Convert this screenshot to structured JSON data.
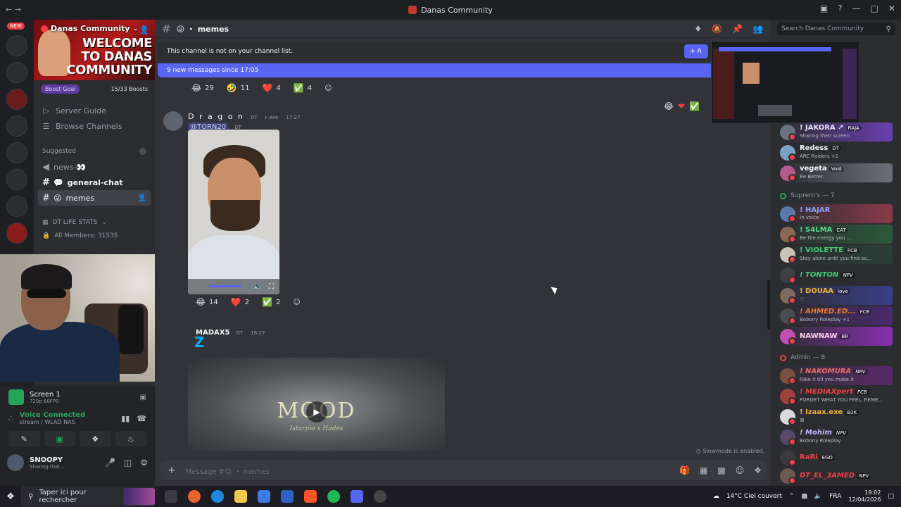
{
  "window": {
    "title": "Danas Community",
    "nav": "←  →"
  },
  "rail": {
    "new_badge": "NEW"
  },
  "server": {
    "name": "Danas Community",
    "banner_text_1": "WELCOME",
    "banner_text_2": "TO DANAS",
    "banner_text_3": "COMMUNITY",
    "boost_label": "Boost Goal",
    "boost_count": "15/33 Boosts",
    "boost_progress": 0.4545
  },
  "sidebar": {
    "server_guide": "Server Guide",
    "browse_channels": "Browse Channels",
    "suggested_label": "Suggested",
    "channels": [
      {
        "icon": "◀",
        "label": "news-👀"
      },
      {
        "icon": "💬",
        "label": "general-chat"
      },
      {
        "icon": "😜",
        "label": "memes"
      }
    ],
    "stats_label": "DT LIFE STATS",
    "all_members": "All Members: 31535"
  },
  "voice": {
    "screen_title": "Screen 1",
    "screen_sub": "720p 60FPS",
    "connected_label": "Voice Connected",
    "connected_sub": "stream / WLAD NAS"
  },
  "user": {
    "name": "SNOOPY",
    "status": "Sharing thei..."
  },
  "channel": {
    "name": "😜 ・ memes",
    "not_listed": "This channel is not on your channel list.",
    "add_button": "+ A",
    "new_messages": "9 new messages since 17:05",
    "reactions_top": [
      {
        "emoji": "😂",
        "count": "29"
      },
      {
        "emoji": "🤣",
        "count": "11"
      },
      {
        "emoji": "❤️",
        "count": "4"
      },
      {
        "emoji": "✅",
        "count": "4"
      }
    ],
    "slowmode": "Slowmode is enabled.",
    "composer_placeholder": "Message #😜 ・ memes"
  },
  "messages": [
    {
      "author": "D r a g o n",
      "tag": "DT",
      "app_tag": "+.exe",
      "time": "17:27",
      "mention": "@TORN20",
      "mention_tag": "DT",
      "reactions": [
        {
          "emoji": "😂",
          "count": "14"
        },
        {
          "emoji": "❤️",
          "count": "2"
        },
        {
          "emoji": "✅",
          "count": "2"
        }
      ]
    },
    {
      "author": "MADAX5",
      "tag": "DT",
      "time": "18:27",
      "text": "Z",
      "media_title": "MOOD",
      "media_sub": "Isturpio x Hades"
    }
  ],
  "members": {
    "search_placeholder": "Search Danas Community",
    "top": [
      {
        "name": "! JAKORA ↗",
        "badge": "RAJA",
        "status": "Sharing their screen",
        "color": "#e8e3ff"
      },
      {
        "name": "Redess",
        "badge": "DT",
        "status": "ARC Raiders +1",
        "color": "#f2f3f5"
      },
      {
        "name": "vegeta",
        "badge": "Void",
        "status": "Be Better.",
        "color": "#f2f3f5"
      }
    ],
    "group1": "Suprem's — 7",
    "supremes": [
      {
        "name": "! HAJAR",
        "badge": "",
        "status": "In voice",
        "color": "#5865f2"
      },
      {
        "name": "! S4LMA",
        "badge": "CAT",
        "status": "Be the energy you ...",
        "color": "#3ba55d"
      },
      {
        "name": "! VIOLETTE",
        "badge": "FCB",
        "status": "Stay alone until you find so...",
        "color": "#23a55a"
      },
      {
        "name": "! TONTON",
        "badge": "NPV",
        "status": "",
        "color": "#3ba55d"
      },
      {
        "name": "! DOUAA",
        "badge": "love",
        "status": "♡",
        "color": "#f0b232"
      },
      {
        "name": "! AHMED.ED...",
        "badge": "FCB",
        "status": "Bobony Roleplay +1",
        "color": "#e67e22"
      },
      {
        "name": "NAWNAW",
        "badge": "BR",
        "status": "",
        "color": "#eb459e"
      }
    ],
    "group2": "Admin — 8",
    "admins": [
      {
        "name": "! NAKOMURA",
        "badge": "NPV",
        "status": "Fake it till you make it",
        "color": "#f23f43"
      },
      {
        "name": "! MEDIAXpert",
        "badge": "FCB",
        "status": "FORGET WHAT YOU FEEL, REME...",
        "color": "#f23f43"
      },
      {
        "name": "! Izaax.exe",
        "badge": "B2K",
        "status": "⌘",
        "color": "#f0b232"
      },
      {
        "name": "! Mohim",
        "badge": "NPV",
        "status": "Bobony Roleplay",
        "color": "#f23f43"
      },
      {
        "name": "RaRi",
        "badge": "EGO",
        "status": "",
        "color": "#f23f43"
      },
      {
        "name": "DT_EL_3AMED",
        "badge": "NPV",
        "status": "",
        "color": "#f23f43"
      }
    ]
  },
  "taskbar": {
    "search_placeholder": "Taper ici pour rechercher",
    "weather": "14°C Ciel couvert",
    "lang": "FRA",
    "time": "19:02",
    "date": "12/04/2026"
  }
}
